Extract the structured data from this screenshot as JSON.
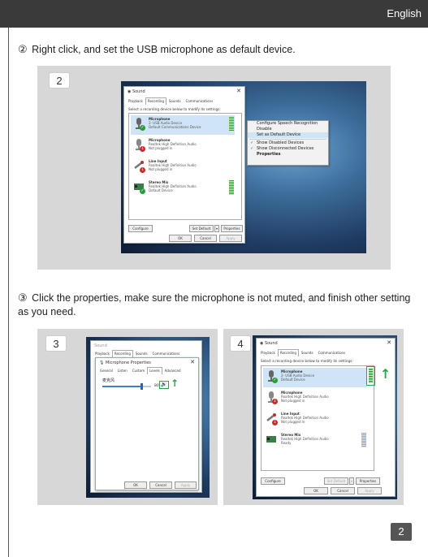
{
  "header": {
    "language": "English"
  },
  "step2": {
    "num": "②",
    "text": "Right click, and set the USB microphone as default device.",
    "badge": "2"
  },
  "step3": {
    "num": "③",
    "text": "Click the properties, make sure the microphone is not muted, and finish other setting as you need.",
    "badge3": "3",
    "badge4": "4"
  },
  "sound_dialog": {
    "title": "Sound",
    "close": "✕",
    "tabs": [
      "Playback",
      "Recording",
      "Sounds",
      "Communications"
    ],
    "hint": "Select a recording device below to modify its settings:",
    "devices": [
      {
        "name": "Microphone",
        "line1": "2- USB Audio Device",
        "line2": "Default Communications Device",
        "status": "✓"
      },
      {
        "name": "Microphone",
        "line1": "Realtek High Definition Audio",
        "line2": "Not plugged in",
        "status": "↓"
      },
      {
        "name": "Line Input",
        "line1": "Realtek High Definition Audio",
        "line2": "Not plugged in",
        "status": "↓"
      },
      {
        "name": "Stereo Mix",
        "line1": "Realtek High Definition Audio",
        "line2": "Default Device",
        "status": "✓"
      }
    ],
    "configure": "Configure",
    "set_default": "Set Default",
    "dropdown": "▾",
    "properties": "Properties",
    "ok": "OK",
    "cancel": "Cancel",
    "apply": "Apply"
  },
  "context_menu": {
    "items": [
      "Configure Speech Recognition",
      "Disable",
      "Set as Default Device",
      "Show Disabled Devices",
      "Show Disconnected Devices",
      "Properties"
    ],
    "check": "✓"
  },
  "mic_props": {
    "title": "Microphone Properties",
    "tabs": [
      "General",
      "Listen",
      "Custom",
      "Levels",
      "Advanced"
    ],
    "level_label": "麦克风",
    "level_value": "80",
    "level_fraction": 0.8,
    "speaker_icon": "🔊",
    "arrow": "↑"
  },
  "step4_devices": [
    {
      "name": "Microphone",
      "line1": "2- USB Audio Device",
      "line2": "Default Device",
      "status": "✓"
    },
    {
      "name": "Microphone",
      "line1": "Realtek High Definition Audio",
      "line2": "Not plugged in",
      "status": "↓"
    },
    {
      "name": "Line Input",
      "line1": "Realtek High Definition Audio",
      "line2": "Not plugged in",
      "status": "↓"
    },
    {
      "name": "Stereo Mix",
      "line1": "Realtek High Definition Audio",
      "line2": "Ready",
      "status": ""
    }
  ],
  "page_number": "2",
  "colors": {
    "topbar": "#3a3a3a",
    "panel": "#d7d7d7",
    "highlight": "#2aa34a",
    "selection": "#cfe4f6"
  }
}
